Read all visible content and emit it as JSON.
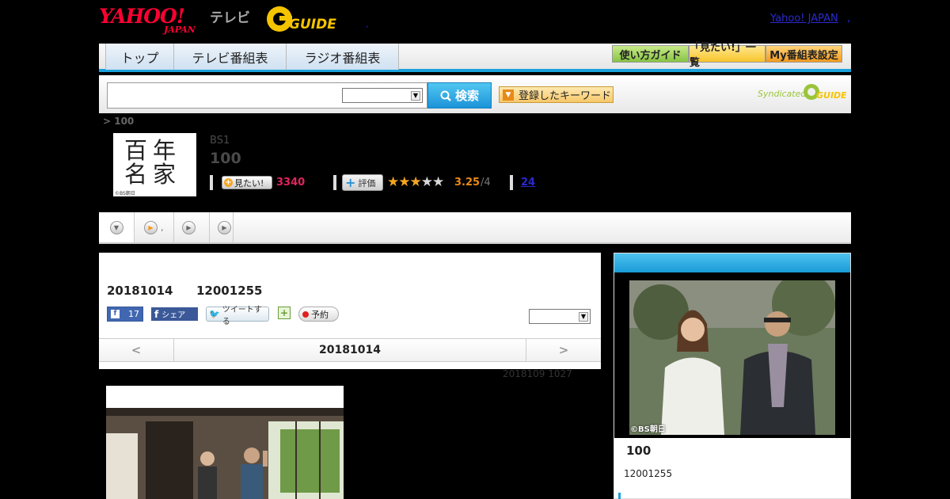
{
  "header": {
    "yahoo_logo": "YAHOO!",
    "yahoo_logo_sub": "JAPAN",
    "tv_label": "テレビ",
    "gguide_logo": "G-GUIDE",
    "top_link": "Yahoo! JAPAN",
    "top_link_extra": ",",
    "link_dot": ","
  },
  "nav": {
    "tabs": [
      {
        "label": "トップ"
      },
      {
        "label": "テレビ番組表"
      },
      {
        "label": "ラジオ番組表"
      }
    ],
    "buttons": [
      {
        "label": "使い方ガイド"
      },
      {
        "label": "「見たい!」一覧"
      },
      {
        "label": "My番組表設定"
      }
    ]
  },
  "search": {
    "button_label": "検索",
    "keyword_button": "登録したキーワード",
    "syndicated": "Syndicated"
  },
  "breadcrumb": "> 100",
  "program": {
    "thumb_text": "百年名家",
    "thumb_copyright": "©BS朝日",
    "channel": "BS1",
    "title": "100",
    "mitai_label": "見たい!",
    "mitai_count": "3340",
    "rate_label": "評価",
    "rating": "3.25",
    "rating_max": "/4",
    "stars_on": 3,
    "stars_total": 5,
    "comments": "24"
  },
  "subtabs": {
    "tab2_dot": ","
  },
  "episode": {
    "date": "20181014",
    "time": "12001255",
    "fb_like_count": "17",
    "fb_share": "シェア",
    "tweet": "ツイートする",
    "reserve": "予約",
    "nav_prev": "<",
    "nav_date": "20181014",
    "nav_next": ">",
    "update_note": "2018109  1027"
  },
  "right_panel": {
    "copyright": "©BS朝日",
    "title": "100",
    "time": "12001255"
  },
  "colors": {
    "accent_blue": "#1aa1db",
    "mitai_pink": "#e0245e",
    "rating_orange": "#e98a17",
    "link_blue": "#2a2ad0"
  }
}
